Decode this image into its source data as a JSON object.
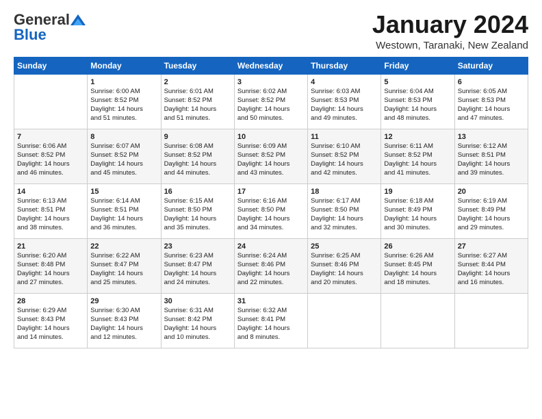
{
  "header": {
    "logo_general": "General",
    "logo_blue": "Blue",
    "month": "January 2024",
    "location": "Westown, Taranaki, New Zealand"
  },
  "days_of_week": [
    "Sunday",
    "Monday",
    "Tuesday",
    "Wednesday",
    "Thursday",
    "Friday",
    "Saturday"
  ],
  "weeks": [
    [
      {
        "day": "",
        "content": ""
      },
      {
        "day": "1",
        "content": "Sunrise: 6:00 AM\nSunset: 8:52 PM\nDaylight: 14 hours\nand 51 minutes."
      },
      {
        "day": "2",
        "content": "Sunrise: 6:01 AM\nSunset: 8:52 PM\nDaylight: 14 hours\nand 51 minutes."
      },
      {
        "day": "3",
        "content": "Sunrise: 6:02 AM\nSunset: 8:52 PM\nDaylight: 14 hours\nand 50 minutes."
      },
      {
        "day": "4",
        "content": "Sunrise: 6:03 AM\nSunset: 8:53 PM\nDaylight: 14 hours\nand 49 minutes."
      },
      {
        "day": "5",
        "content": "Sunrise: 6:04 AM\nSunset: 8:53 PM\nDaylight: 14 hours\nand 48 minutes."
      },
      {
        "day": "6",
        "content": "Sunrise: 6:05 AM\nSunset: 8:53 PM\nDaylight: 14 hours\nand 47 minutes."
      }
    ],
    [
      {
        "day": "7",
        "content": "Sunrise: 6:06 AM\nSunset: 8:52 PM\nDaylight: 14 hours\nand 46 minutes."
      },
      {
        "day": "8",
        "content": "Sunrise: 6:07 AM\nSunset: 8:52 PM\nDaylight: 14 hours\nand 45 minutes."
      },
      {
        "day": "9",
        "content": "Sunrise: 6:08 AM\nSunset: 8:52 PM\nDaylight: 14 hours\nand 44 minutes."
      },
      {
        "day": "10",
        "content": "Sunrise: 6:09 AM\nSunset: 8:52 PM\nDaylight: 14 hours\nand 43 minutes."
      },
      {
        "day": "11",
        "content": "Sunrise: 6:10 AM\nSunset: 8:52 PM\nDaylight: 14 hours\nand 42 minutes."
      },
      {
        "day": "12",
        "content": "Sunrise: 6:11 AM\nSunset: 8:52 PM\nDaylight: 14 hours\nand 41 minutes."
      },
      {
        "day": "13",
        "content": "Sunrise: 6:12 AM\nSunset: 8:51 PM\nDaylight: 14 hours\nand 39 minutes."
      }
    ],
    [
      {
        "day": "14",
        "content": "Sunrise: 6:13 AM\nSunset: 8:51 PM\nDaylight: 14 hours\nand 38 minutes."
      },
      {
        "day": "15",
        "content": "Sunrise: 6:14 AM\nSunset: 8:51 PM\nDaylight: 14 hours\nand 36 minutes."
      },
      {
        "day": "16",
        "content": "Sunrise: 6:15 AM\nSunset: 8:50 PM\nDaylight: 14 hours\nand 35 minutes."
      },
      {
        "day": "17",
        "content": "Sunrise: 6:16 AM\nSunset: 8:50 PM\nDaylight: 14 hours\nand 34 minutes."
      },
      {
        "day": "18",
        "content": "Sunrise: 6:17 AM\nSunset: 8:50 PM\nDaylight: 14 hours\nand 32 minutes."
      },
      {
        "day": "19",
        "content": "Sunrise: 6:18 AM\nSunset: 8:49 PM\nDaylight: 14 hours\nand 30 minutes."
      },
      {
        "day": "20",
        "content": "Sunrise: 6:19 AM\nSunset: 8:49 PM\nDaylight: 14 hours\nand 29 minutes."
      }
    ],
    [
      {
        "day": "21",
        "content": "Sunrise: 6:20 AM\nSunset: 8:48 PM\nDaylight: 14 hours\nand 27 minutes."
      },
      {
        "day": "22",
        "content": "Sunrise: 6:22 AM\nSunset: 8:47 PM\nDaylight: 14 hours\nand 25 minutes."
      },
      {
        "day": "23",
        "content": "Sunrise: 6:23 AM\nSunset: 8:47 PM\nDaylight: 14 hours\nand 24 minutes."
      },
      {
        "day": "24",
        "content": "Sunrise: 6:24 AM\nSunset: 8:46 PM\nDaylight: 14 hours\nand 22 minutes."
      },
      {
        "day": "25",
        "content": "Sunrise: 6:25 AM\nSunset: 8:46 PM\nDaylight: 14 hours\nand 20 minutes."
      },
      {
        "day": "26",
        "content": "Sunrise: 6:26 AM\nSunset: 8:45 PM\nDaylight: 14 hours\nand 18 minutes."
      },
      {
        "day": "27",
        "content": "Sunrise: 6:27 AM\nSunset: 8:44 PM\nDaylight: 14 hours\nand 16 minutes."
      }
    ],
    [
      {
        "day": "28",
        "content": "Sunrise: 6:29 AM\nSunset: 8:43 PM\nDaylight: 14 hours\nand 14 minutes."
      },
      {
        "day": "29",
        "content": "Sunrise: 6:30 AM\nSunset: 8:43 PM\nDaylight: 14 hours\nand 12 minutes."
      },
      {
        "day": "30",
        "content": "Sunrise: 6:31 AM\nSunset: 8:42 PM\nDaylight: 14 hours\nand 10 minutes."
      },
      {
        "day": "31",
        "content": "Sunrise: 6:32 AM\nSunset: 8:41 PM\nDaylight: 14 hours\nand 8 minutes."
      },
      {
        "day": "",
        "content": ""
      },
      {
        "day": "",
        "content": ""
      },
      {
        "day": "",
        "content": ""
      }
    ]
  ]
}
